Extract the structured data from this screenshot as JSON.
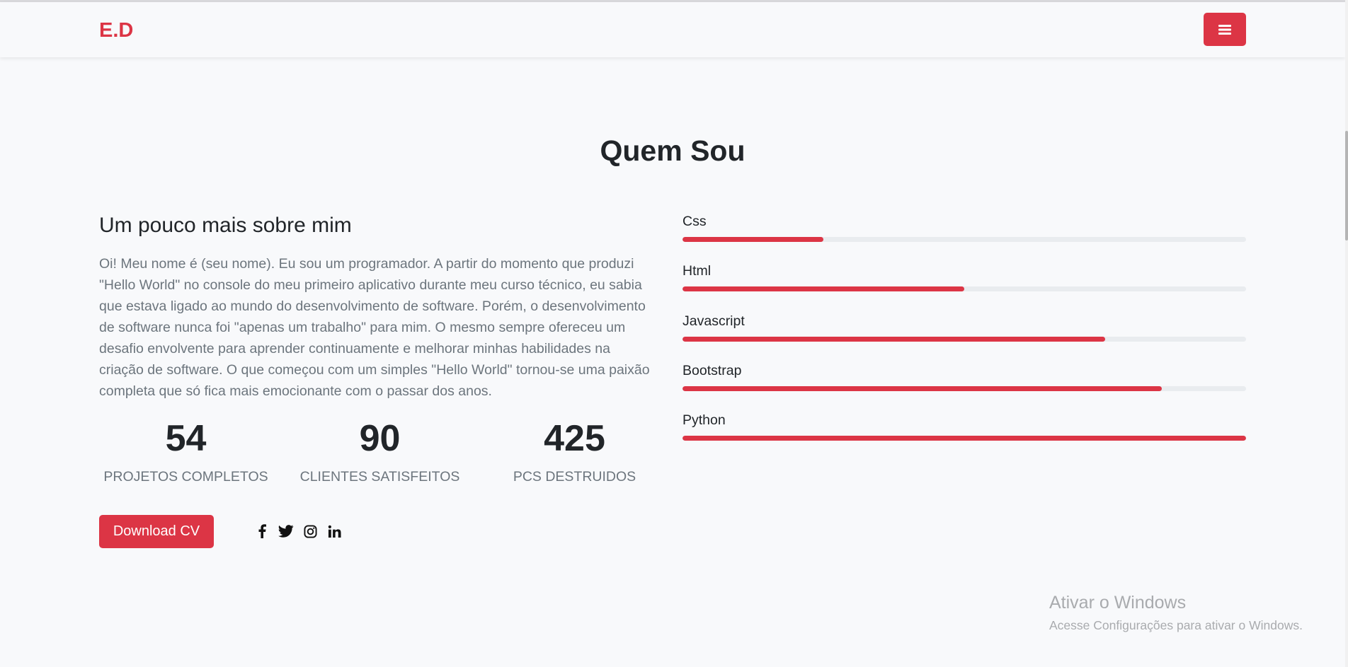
{
  "navbar": {
    "brand": "E.D",
    "menu_icon": "hamburger-icon"
  },
  "section": {
    "title": "Quem Sou"
  },
  "about": {
    "subtitle": "Um pouco mais sobre mim",
    "paragraph": "Oi! Meu nome é (seu nome). Eu sou um programador. A partir do momento que produzi \"Hello World\" no console do meu primeiro aplicativo durante meu curso técnico, eu sabia que estava ligado ao mundo do desenvolvimento de software. Porém, o desenvolvimento de software nunca foi \"apenas um trabalho\" para mim. O mesmo sempre ofereceu um desafio envolvente para aprender continuamente e melhorar minhas habilidades na criação de software. O que começou com um simples \"Hello World\" tornou-se uma paixão completa que só fica mais emocionante com o passar dos anos."
  },
  "stats": [
    {
      "number": "54",
      "label": "PROJETOS COMPLETOS"
    },
    {
      "number": "90",
      "label": "CLIENTES SATISFEITOS"
    },
    {
      "number": "425",
      "label": "PCS DESTRUIDOS"
    }
  ],
  "actions": {
    "download_label": "Download CV"
  },
  "socials": [
    "facebook-icon",
    "twitter-icon",
    "instagram-icon",
    "linkedin-icon"
  ],
  "skills": [
    {
      "name": "Css",
      "percent": 25
    },
    {
      "name": "Html",
      "percent": 50
    },
    {
      "name": "Javascript",
      "percent": 75
    },
    {
      "name": "Bootstrap",
      "percent": 85
    },
    {
      "name": "Python",
      "percent": 100
    }
  ],
  "colors": {
    "accent": "#dc3545",
    "track": "#e9ecef",
    "muted_text": "#6c757d"
  },
  "watermark": {
    "title": "Ativar o Windows",
    "subtitle": "Acesse Configurações para ativar o Windows."
  }
}
